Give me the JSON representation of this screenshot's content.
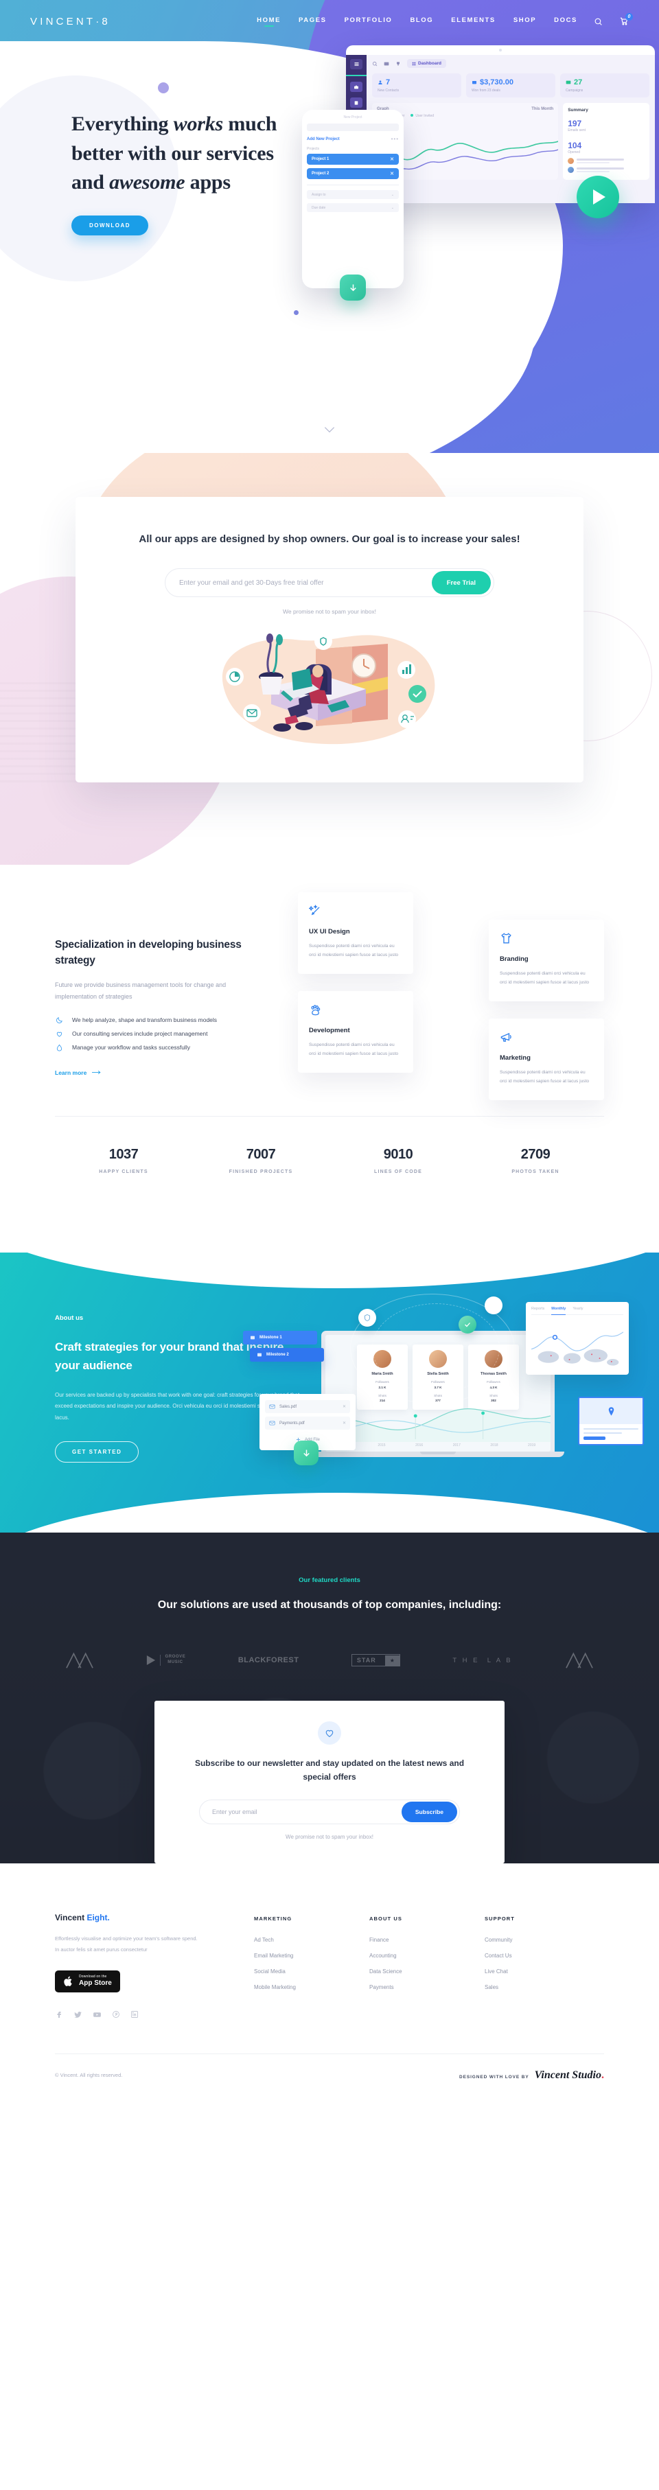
{
  "header": {
    "brand": "VINCENT·8",
    "nav": [
      {
        "label": "HOME",
        "active": true
      },
      {
        "label": "PAGES",
        "active": false
      },
      {
        "label": "PORTFOLIO",
        "active": false
      },
      {
        "label": "BLOG",
        "active": false
      },
      {
        "label": "ELEMENTS",
        "active": false
      },
      {
        "label": "SHOP",
        "active": false
      },
      {
        "label": "DOCS",
        "active": false
      }
    ],
    "search_icon": "search-icon",
    "cart_icon": "cart-icon",
    "cart_count": "0"
  },
  "hero": {
    "title_line1": "Everything ",
    "title_em1": "works",
    "title_line1b": " much",
    "title_line2": "better with our services",
    "title_line3a": "and ",
    "title_em2": "awesome",
    "title_line3b": " apps",
    "cta": "DOWNLOAD",
    "play_icon": "play-button",
    "scroll_cue": "chevron-down-icon",
    "dashboard": {
      "menu_label": "Dashboard",
      "stats": [
        {
          "value": "7",
          "label": "New Contacts",
          "icon": "user-icon"
        },
        {
          "value": "$3,730.00",
          "label": "Won from 23 deals",
          "icon": "wallet-icon"
        },
        {
          "value": "27",
          "label": "Campaigns",
          "icon": "mail-icon"
        }
      ],
      "graph_title": "Graph",
      "graph_range": "This Month",
      "legend": [
        {
          "label": "Domain Owner"
        },
        {
          "label": "User Invited"
        }
      ],
      "summary_title": "Summary",
      "summary_items": [
        {
          "value": "197",
          "label": "Emails sent"
        },
        {
          "value": "104",
          "label": "Opened"
        }
      ]
    },
    "phone": {
      "header": "New Project",
      "add_label": "Add New Project",
      "more_icon": "more-dots-icon",
      "section_label": "Projects",
      "items": [
        {
          "label": "Project 1"
        },
        {
          "label": "Project 2"
        }
      ],
      "fields": [
        {
          "label": "Assign to"
        },
        {
          "label": "Due date"
        }
      ],
      "fab_icon": "download-icon"
    }
  },
  "offer": {
    "title": "All our apps are designed by shop owners. Our goal is to increase your sales!",
    "input_placeholder": "Enter your email and get 30-Days free trial offer",
    "input_value": "",
    "button": "Free Trial",
    "note": "We promise not to spam your inbox!",
    "illustration": "woman-working-on-laptop-illustration"
  },
  "spec": {
    "heading": "Specialization in developing business strategy",
    "paragraph": "Future we provide business management tools for change and implementation of strategies",
    "bullets": [
      {
        "icon": "moon-icon",
        "text": "We help analyze, shape and transform business models"
      },
      {
        "icon": "heart-icon",
        "text": "Our consulting services include project management"
      },
      {
        "icon": "droplet-icon",
        "text": "Manage your workflow and tasks successfully"
      }
    ],
    "learn_more": "Learn more",
    "cards": [
      {
        "icon": "magic-wand-icon",
        "title": "UX UI Design",
        "desc": "Suspendisse potenti diami orci vehicula eu orci id molestiemi sapien fusce at lacus justo"
      },
      {
        "icon": "t-shirt-icon",
        "title": "Branding",
        "desc": "Suspendisse potenti diami orci vehicula eu orci id molestiemi sapien fusce at lacus justo"
      },
      {
        "icon": "paw-icon",
        "title": "Development",
        "desc": "Suspendisse potenti diami orci vehicula eu orci id molestiemi sapien fusce at lacus justo"
      },
      {
        "icon": "megaphone-icon",
        "title": "Marketing",
        "desc": "Suspendisse potenti diami orci vehicula eu orci id molestiemi sapien fusce at lacus justo"
      }
    ]
  },
  "stats": [
    {
      "number": "1037",
      "label": "HAPPY CLIENTS"
    },
    {
      "number": "7007",
      "label": "FINISHED PROJECTS"
    },
    {
      "number": "9010",
      "label": "LINES OF CODE"
    },
    {
      "number": "2709",
      "label": "PHOTOS TAKEN"
    }
  ],
  "about": {
    "kicker": "About us",
    "heading": "Craft strategies for your brand that inspire your audience",
    "paragraph": "Our services are backed up by specialists that work with one goal: craft strategies for your brand that exceed expectations and inspire your audience. Orci vehicula eu orci id molestiemi sapien fusce at lacus.",
    "cta": "GET STARTED",
    "mock": {
      "milestones": [
        {
          "label": "Milestone 1"
        },
        {
          "label": "Milestone 2"
        }
      ],
      "files": [
        {
          "name": "Sales.pdf"
        },
        {
          "name": "Payments.pdf"
        }
      ],
      "add_file": "Add File",
      "people": [
        {
          "name": "Maria Smith",
          "followers_label": "Followers",
          "followers": "2.1 K",
          "shots_label": "Shots",
          "shots": "214"
        },
        {
          "name": "Stella Smith",
          "followers_label": "Followers",
          "followers": "3.7 K",
          "shots_label": "Shots",
          "shots": "377"
        },
        {
          "name": "Thomas Smith",
          "followers_label": "Followers",
          "followers": "4.3 K",
          "shots_label": "Shots",
          "shots": "302"
        }
      ],
      "years": [
        "2014",
        "2015",
        "2016",
        "2017",
        "2018",
        "2019"
      ],
      "analytics_tabs": [
        {
          "label": "Reports",
          "active": false
        },
        {
          "label": "Monthly",
          "active": true
        },
        {
          "label": "Yearly",
          "active": false
        }
      ],
      "download_icon": "download-icon",
      "location_icon": "map-pin-icon",
      "shield_icon": "shield-icon",
      "check_icon": "check-icon"
    }
  },
  "clients": {
    "kicker": "Our featured clients",
    "heading": "Our solutions are used at thousands of top companies, including:",
    "logos": [
      {
        "name": "mountain-logo",
        "text": ""
      },
      {
        "name": "groove-music-logo",
        "text": "GROOVE MUSIC"
      },
      {
        "name": "blackforest-logo",
        "text": "BLACKFOREST"
      },
      {
        "name": "star-logo",
        "text": "STAR"
      },
      {
        "name": "the-lab-logo",
        "text": "THE LAB"
      },
      {
        "name": "mountain-logo-2",
        "text": ""
      }
    ]
  },
  "subscribe": {
    "icon": "heart-icon",
    "title": "Subscribe to our newsletter and stay updated on the latest news and special offers",
    "input_placeholder": "Enter your email",
    "input_value": "",
    "button": "Subscribe",
    "note": "We promise not to spam your inbox!"
  },
  "footer": {
    "logo_a": "Vincent ",
    "logo_b": "Eight.",
    "desc": "Effortlessly visualise and optimize your team's software spend. In auctor felis sit amet purus consectetur",
    "appstore_small": "Download on the",
    "appstore_big": "App Store",
    "socials": [
      {
        "name": "facebook-icon"
      },
      {
        "name": "twitter-icon"
      },
      {
        "name": "youtube-icon"
      },
      {
        "name": "pinterest-icon"
      },
      {
        "name": "linkedin-icon"
      }
    ],
    "columns": [
      {
        "heading": "MARKETING",
        "links": [
          "Ad Tech",
          "Email Marketing",
          "Social Media",
          "Mobile Marketing"
        ]
      },
      {
        "heading": "ABOUT US",
        "links": [
          "Finance",
          "Accounting",
          "Data Science",
          "Payments"
        ]
      },
      {
        "heading": "SUPPORT",
        "links": [
          "Community",
          "Contact Us",
          "Live Chat",
          "Sales"
        ]
      }
    ],
    "copyright": "© Vincent. All rights reserved.",
    "credit_label": "DESIGNED WITH LOVE BY",
    "credit_name": "Vincent Studio"
  },
  "colors": {
    "accent_blue": "#1a9ee8",
    "accent_teal": "#1ecfae",
    "brand_blue": "#2176f0",
    "dark": "#242936",
    "clients_accent": "#1fd9c5"
  }
}
